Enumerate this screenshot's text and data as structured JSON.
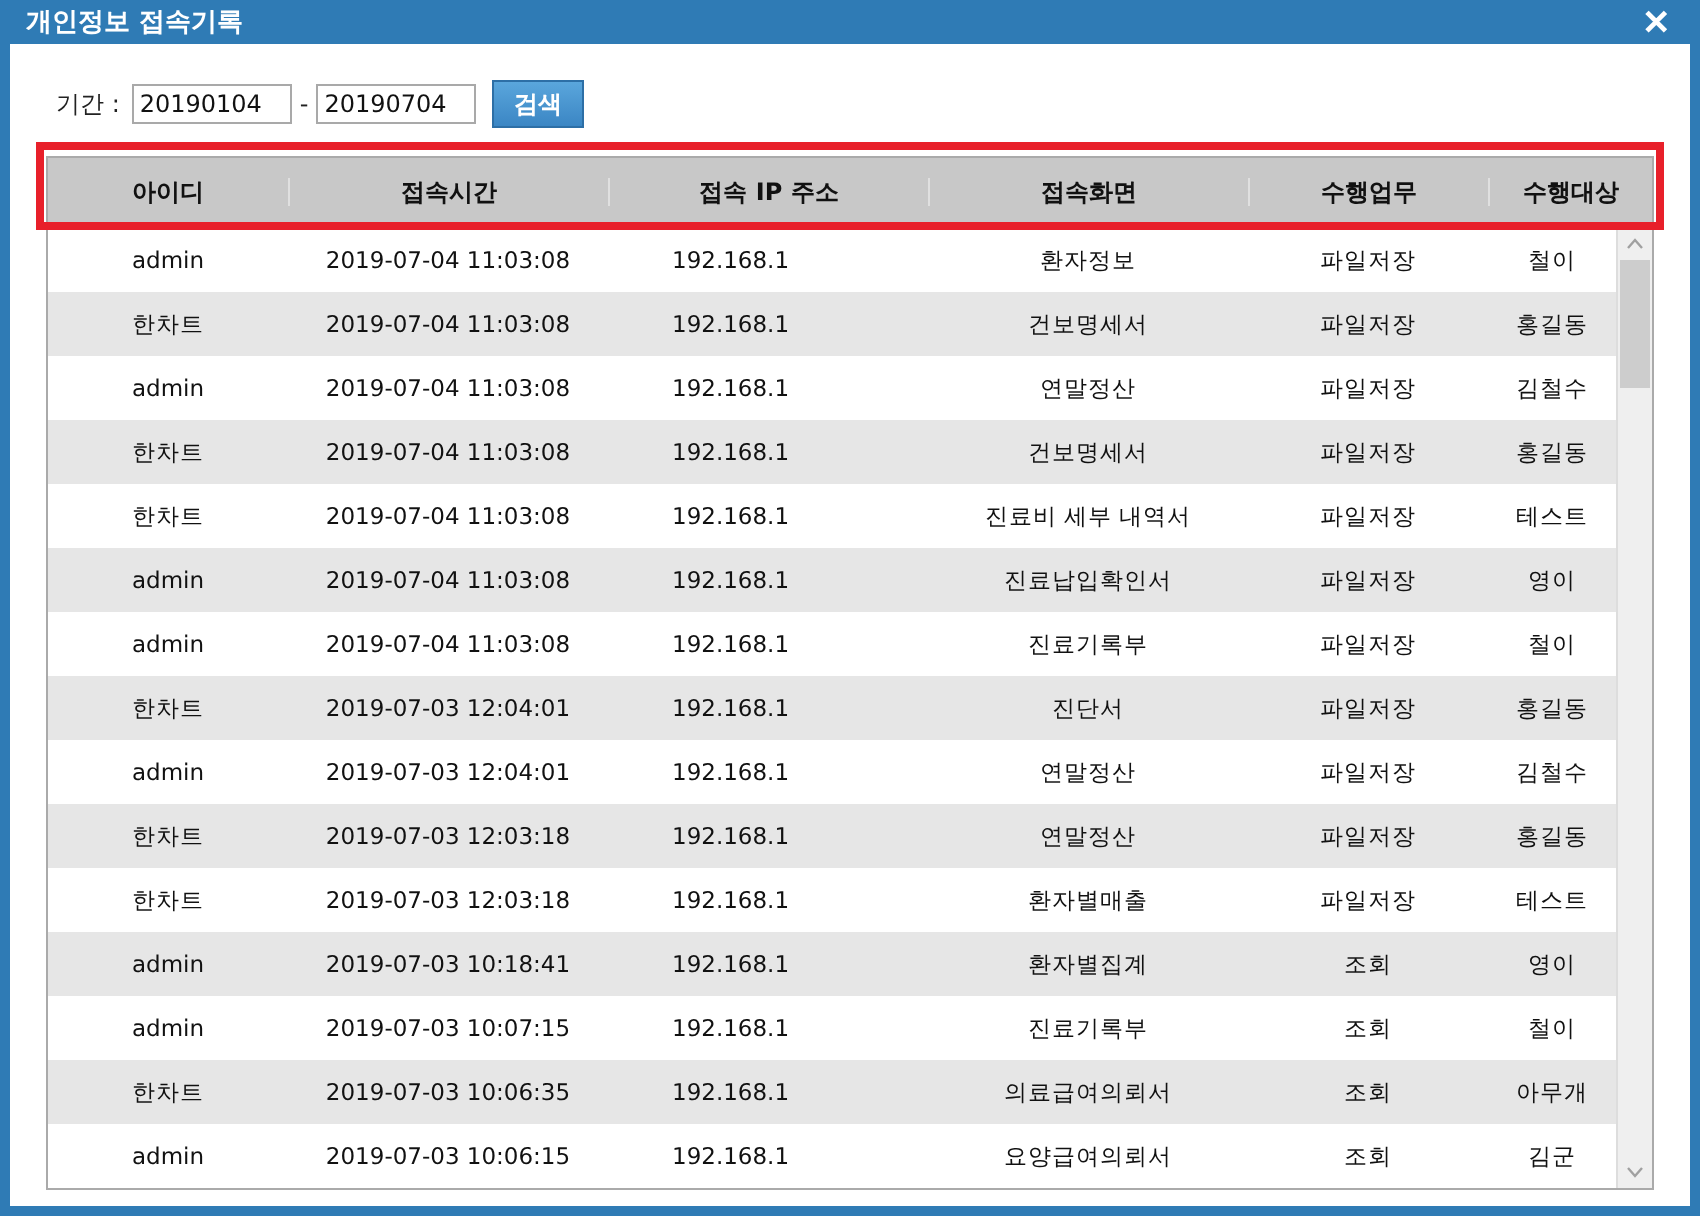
{
  "window": {
    "title": "개인정보 접속기록",
    "close": "✕"
  },
  "filter": {
    "label": "기간 :",
    "from": "20190104",
    "separator": "-",
    "to": "20190704",
    "button": "검색"
  },
  "table": {
    "header_highlighted": true,
    "columns": [
      "아이디",
      "접속시간",
      "접속 IP 주소",
      "접속화면",
      "수행업무",
      "수행대상"
    ],
    "rows": [
      [
        "admin",
        "2019-07-04 11:03:08",
        "192.168.1",
        "환자정보",
        "파일저장",
        "철이"
      ],
      [
        "한차트",
        "2019-07-04 11:03:08",
        "192.168.1",
        "건보명세서",
        "파일저장",
        "홍길동"
      ],
      [
        "admin",
        "2019-07-04 11:03:08",
        "192.168.1",
        "연말정산",
        "파일저장",
        "김철수"
      ],
      [
        "한차트",
        "2019-07-04 11:03:08",
        "192.168.1",
        "건보명세서",
        "파일저장",
        "홍길동"
      ],
      [
        "한차트",
        "2019-07-04 11:03:08",
        "192.168.1",
        "진료비 세부 내역서",
        "파일저장",
        "테스트"
      ],
      [
        "admin",
        "2019-07-04 11:03:08",
        "192.168.1",
        "진료납입확인서",
        "파일저장",
        "영이"
      ],
      [
        "admin",
        "2019-07-04 11:03:08",
        "192.168.1",
        "진료기록부",
        "파일저장",
        "철이"
      ],
      [
        "한차트",
        "2019-07-03 12:04:01",
        "192.168.1",
        "진단서",
        "파일저장",
        "홍길동"
      ],
      [
        "admin",
        "2019-07-03 12:04:01",
        "192.168.1",
        "연말정산",
        "파일저장",
        "김철수"
      ],
      [
        "한차트",
        "2019-07-03 12:03:18",
        "192.168.1",
        "연말정산",
        "파일저장",
        "홍길동"
      ],
      [
        "한차트",
        "2019-07-03 12:03:18",
        "192.168.1",
        "환자별매출",
        "파일저장",
        "테스트"
      ],
      [
        "admin",
        "2019-07-03 10:18:41",
        "192.168.1",
        "환자별집계",
        "조회",
        "영이"
      ],
      [
        "admin",
        "2019-07-03 10:07:15",
        "192.168.1",
        "진료기록부",
        "조회",
        "철이"
      ],
      [
        "한차트",
        "2019-07-03 10:06:35",
        "192.168.1",
        "의료급여의뢰서",
        "조회",
        "아무개"
      ],
      [
        "admin",
        "2019-07-03 10:06:15",
        "192.168.1",
        "요양급여의뢰서",
        "조회",
        "김군"
      ]
    ]
  }
}
